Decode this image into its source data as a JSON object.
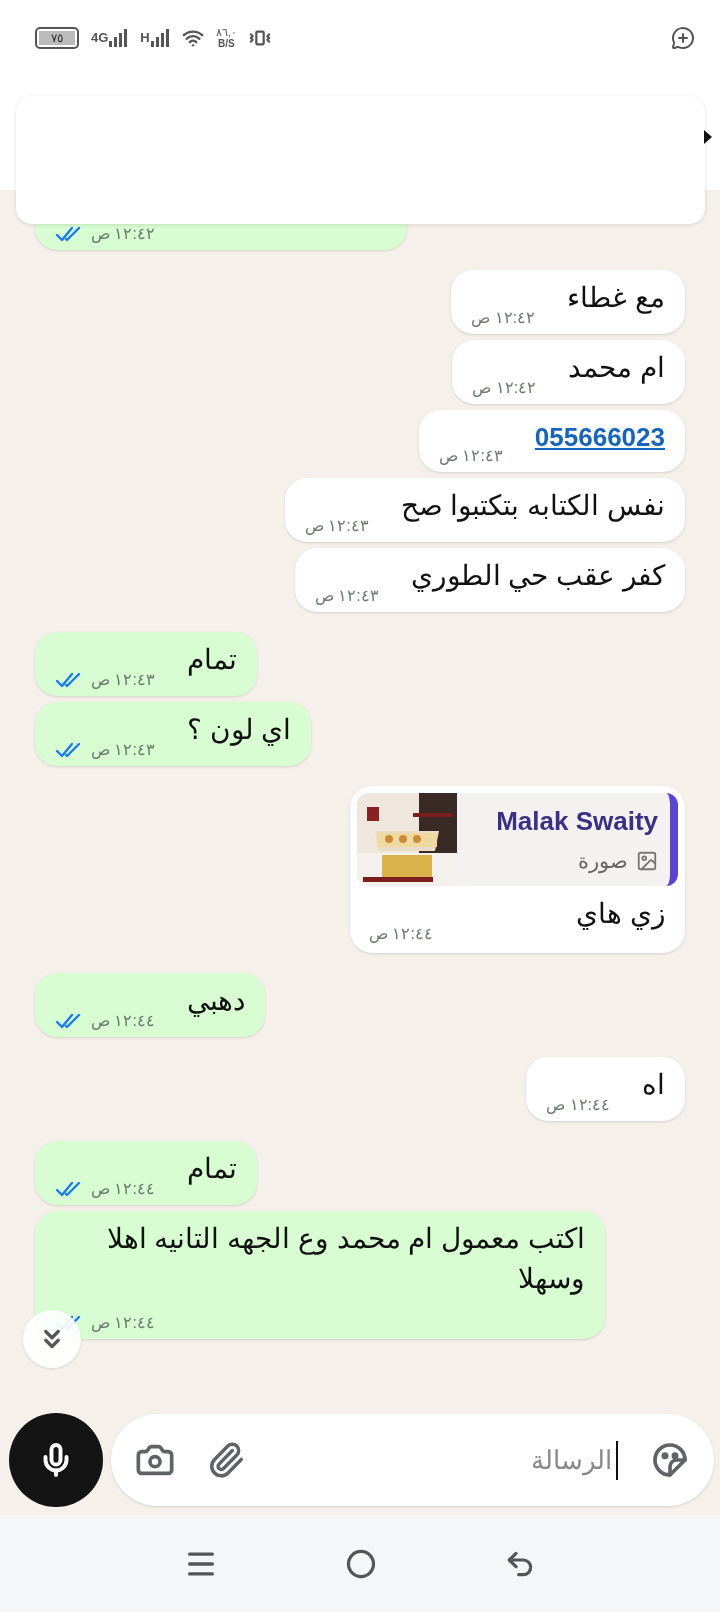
{
  "status_bar": {
    "battery": "٧٥",
    "network_1": "4G",
    "network_2": "H",
    "speed": "٨٦,٠",
    "speed_unit": "B/S"
  },
  "messages": [
    {
      "outgoing": true,
      "kind": "text",
      "time": "١٢:٤٢ ص",
      "read": true
    },
    {
      "outgoing": false,
      "kind": "text",
      "text": "مع غطاء",
      "time": "١٢:٤٢ ص"
    },
    {
      "outgoing": false,
      "kind": "text",
      "text": "ام محمد",
      "time": "١٢:٤٢ ص"
    },
    {
      "outgoing": false,
      "kind": "link",
      "text": "055666023",
      "time": "١٢:٤٣ ص"
    },
    {
      "outgoing": false,
      "kind": "text",
      "text": "نفس الكتابه بتكتبوا صح",
      "time": "١٢:٤٣ ص"
    },
    {
      "outgoing": false,
      "kind": "text",
      "text": "كفر عقب حي الطوري",
      "time": "١٢:٤٣ ص"
    },
    {
      "outgoing": true,
      "kind": "text",
      "text": "تمام",
      "time": "١٢:٤٣ ص",
      "read": true
    },
    {
      "outgoing": true,
      "kind": "text",
      "text": "اي لون ؟",
      "time": "١٢:٤٣ ص",
      "read": true
    },
    {
      "outgoing": false,
      "kind": "quote",
      "quote": {
        "author": "Malak Swaity",
        "label": "صورة",
        "kind": "picture"
      },
      "text": "زي هاي",
      "time": "١٢:٤٤ ص"
    },
    {
      "outgoing": true,
      "kind": "text",
      "text": "دهبي",
      "time": "١٢:٤٤ ص",
      "read": true
    },
    {
      "outgoing": false,
      "kind": "text",
      "text": "اه",
      "time": "١٢:٤٤ ص"
    },
    {
      "outgoing": true,
      "kind": "text",
      "text": "تمام",
      "time": "١٢:٤٤ ص",
      "read": true
    },
    {
      "outgoing": true,
      "kind": "text",
      "text": "اكتب معمول ام محمد وع الجهه التانيه اهلا وسهلا",
      "time": "١٢:٤٤ ص",
      "read": true
    }
  ],
  "composer": {
    "placeholder": "الرسالة"
  }
}
